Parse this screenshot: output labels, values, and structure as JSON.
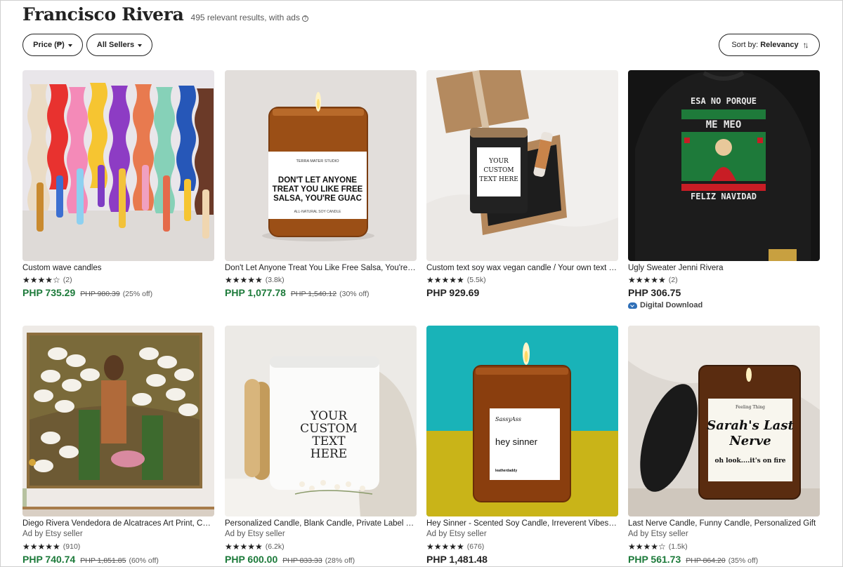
{
  "header": {
    "title": "Francisco Rivera",
    "result_count": "495 relevant results, with ads"
  },
  "filters": {
    "price_label": "Price (₱)",
    "sellers_label": "All Sellers"
  },
  "sort": {
    "prefix": "Sort by:",
    "value": "Relevancy"
  },
  "colors": {
    "sale_price": "#1c7a3a",
    "digital_download_icon": "#2f6fb7"
  },
  "listings": [
    {
      "name": "Custom wave candles",
      "ad_label": "",
      "stars": "★★★★☆",
      "reviews": "(2)",
      "price": "PHP 735.29",
      "original_price": "PHP 980.39",
      "discount": "(25% off)",
      "badge": "",
      "image_icon": "wave-candles-image"
    },
    {
      "name": "Don't Let Anyone Treat You Like Free Salsa, You're Guac Candle",
      "ad_label": "",
      "stars": "★★★★★",
      "reviews": "(3.8k)",
      "price": "PHP 1,077.78",
      "original_price": "PHP 1,540.12",
      "discount": "(30% off)",
      "badge": "",
      "image_icon": "candle-jar-image",
      "label_brand": "TERRA MATER STUDIO",
      "label_text": "DON'T LET ANYONE TREAT YOU LIKE FREE SALSA, YOU'RE GUAC",
      "label_sub": "ALL-NATURAL SOY CANDLE"
    },
    {
      "name": "Custom text soy wax vegan candle / Your own text candle gift box",
      "ad_label": "",
      "stars": "★★★★★",
      "reviews": "(5.5k)",
      "price": "PHP 929.69",
      "original_price": "",
      "discount": "",
      "badge": "",
      "image_icon": "gift-box-candle-image",
      "label_text": "YOUR CUSTOM TEXT HERE"
    },
    {
      "name": "Ugly Sweater Jenni Rivera",
      "ad_label": "",
      "stars": "★★★★★",
      "reviews": "(2)",
      "price": "PHP 306.75",
      "original_price": "",
      "discount": "",
      "badge": "Digital Download",
      "image_icon": "ugly-sweater-image",
      "sweater_top": "ESA NO PORQUE",
      "sweater_mid": "ME MEO",
      "sweater_bottom": "FELIZ NAVIDAD"
    },
    {
      "name": "Diego Rivera Vendedora de Alcatraces Art Print, Calla Lily Wall Art",
      "ad_label": "Ad by Etsy seller",
      "stars": "★★★★★",
      "reviews": "(910)",
      "price": "PHP 740.74",
      "original_price": "PHP 1,851.85",
      "discount": "(60% off)",
      "badge": "",
      "image_icon": "calla-lily-painting-image"
    },
    {
      "name": "Personalized Candle, Blank Candle, Private Label Candle, Custom Gift",
      "ad_label": "Ad by Etsy seller",
      "stars": "★★★★★",
      "reviews": "(6.2k)",
      "price": "PHP 600.00",
      "original_price": "PHP 833.33",
      "discount": "(28% off)",
      "badge": "",
      "image_icon": "white-candle-image",
      "label_text": "YOUR CUSTOM TEXT HERE"
    },
    {
      "name": "Hey Sinner - Scented Soy Candle, Irreverent Vibes Gift",
      "ad_label": "Ad by Etsy seller",
      "stars": "★★★★★",
      "reviews": "(676)",
      "price": "PHP 1,481.48",
      "original_price": "",
      "discount": "",
      "badge": "",
      "image_icon": "hey-sinner-candle-image",
      "label_brand": "SassyAss",
      "label_text": "hey sinner",
      "label_sub": "leatherdaddy"
    },
    {
      "name": "Last Nerve Candle, Funny Candle, Personalized Gift",
      "ad_label": "Ad by Etsy seller",
      "stars": "★★★★☆",
      "reviews": "(1.5k)",
      "price": "PHP 561.73",
      "original_price": "PHP 864.20",
      "discount": "(35% off)",
      "badge": "",
      "image_icon": "last-nerve-candle-image",
      "label_brand": "Feeling Thing",
      "label_text": "Sarah's Last Nerve",
      "label_sub": "oh look....it's on fire"
    }
  ]
}
